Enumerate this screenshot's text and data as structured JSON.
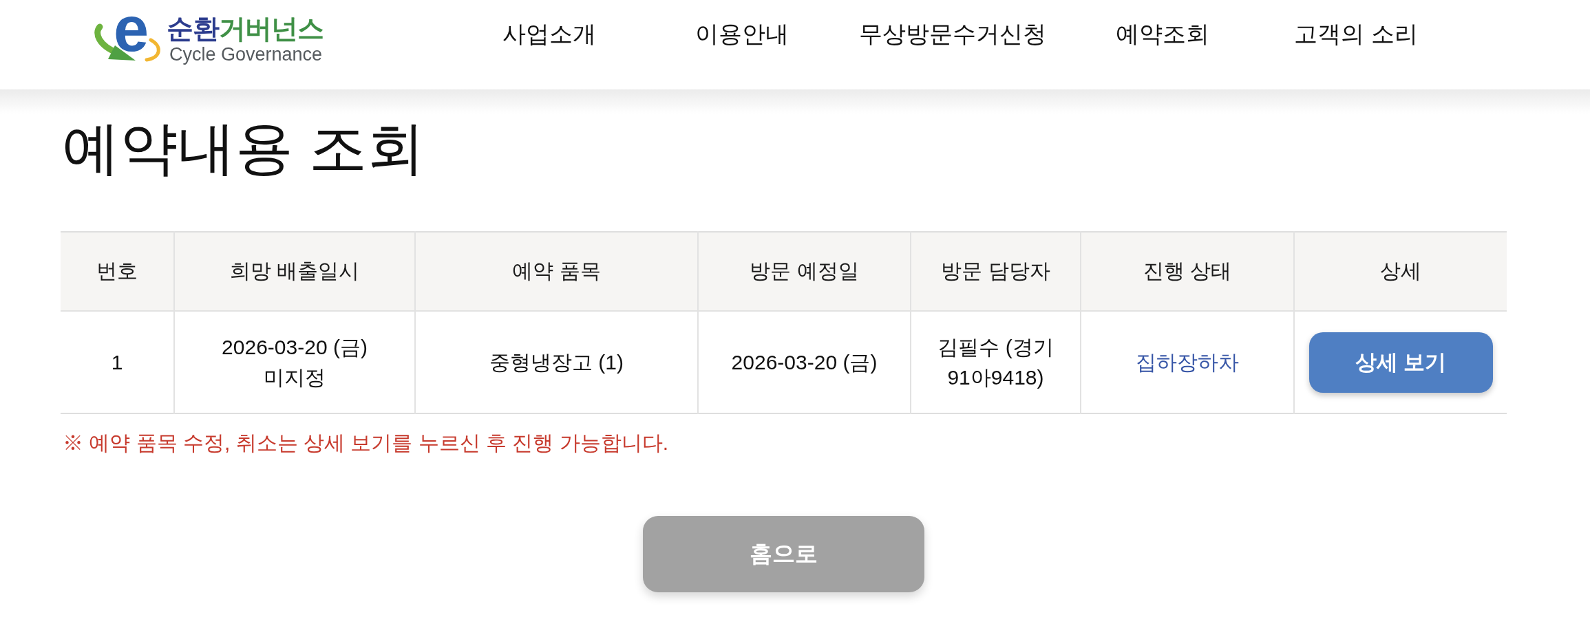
{
  "header": {
    "logo": {
      "mark": "e",
      "name_primary": "순환",
      "name_secondary": "거버넌스",
      "subtitle": "Cycle Governance"
    },
    "nav": [
      "사업소개",
      "이용안내",
      "무상방문수거신청",
      "예약조회",
      "고객의 소리"
    ]
  },
  "page_title": "예약내용 조회",
  "table": {
    "columns": [
      "번호",
      "희망 배출일시",
      "예약 품목",
      "방문 예정일",
      "방문 담당자",
      "진행 상태",
      "상세"
    ],
    "rows": [
      {
        "number": "1",
        "preferred_datetime": "2026-03-20 (금)\n미지정",
        "items": "중형냉장고 (1)",
        "visit_date": "2026-03-20 (금)",
        "visitor": "김필수 (경기 91아9418)",
        "status": "집하장하차",
        "detail_button": "상세 보기"
      }
    ]
  },
  "notice": "※ 예약 품목 수정, 취소는 상세 보기를 누르신 후 진행 가능합니다.",
  "home_button": "홈으로"
}
